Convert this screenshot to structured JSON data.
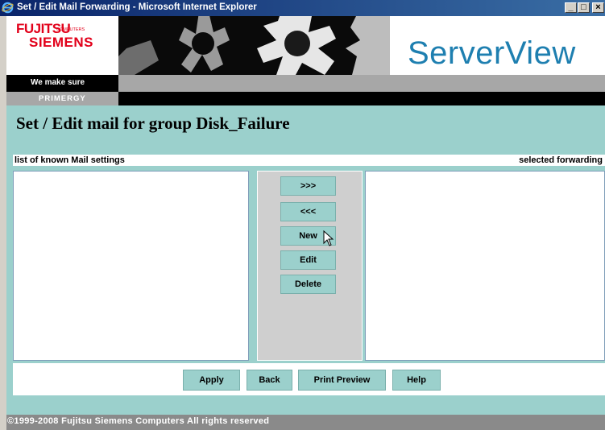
{
  "window": {
    "title": "Set / Edit Mail Forwarding - Microsoft Internet Explorer",
    "controls": [
      "_",
      "□",
      "×"
    ]
  },
  "header": {
    "logo_line1": "FUJITSU",
    "logo_computers": "COMPUTERS",
    "logo_line2": "SIEMENS",
    "product": "ServerView",
    "tagline": "We make sure",
    "section": "PRIMERGY"
  },
  "page": {
    "title": "Set / Edit mail for group Disk_Failure",
    "left_list_header": "list of known Mail settings",
    "right_list_header": "selected forwarding"
  },
  "panel_buttons": {
    "add": ">>>",
    "remove": "<<<",
    "new": "New",
    "edit": "Edit",
    "delete": "Delete"
  },
  "bottom_buttons": {
    "apply": "Apply",
    "back": "Back",
    "print_preview": "Print Preview",
    "help": "Help"
  },
  "footer": {
    "copyright": "©1999-2008  Fujitsu Siemens Computers  All rights reserved"
  },
  "colors": {
    "teal": "#9bd0cc",
    "brand_red": "#e2001a",
    "serverview_blue": "#1e7fb0",
    "titlebar": "#0a246a"
  }
}
